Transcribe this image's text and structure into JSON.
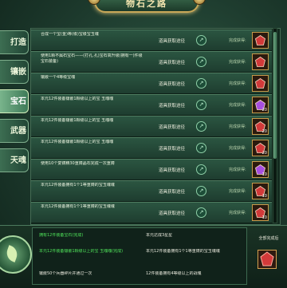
{
  "header": {
    "title": "物石之路"
  },
  "sidebar": {
    "tabs": [
      {
        "label": "打造",
        "active": false
      },
      {
        "label": "镶嵌",
        "active": false
      },
      {
        "label": "宝石",
        "active": true
      },
      {
        "label": "武器",
        "active": false
      },
      {
        "label": "天魂",
        "active": false
      }
    ]
  },
  "tasks": [
    {
      "desc": "合成一个宝(金)等(级)宝级宝玉魂",
      "obtain_label": "道具获取途径",
      "status": "完成获得:",
      "reward_icon": "red-gem",
      "reward_color": "#d23a3a",
      "qty": ""
    },
    {
      "desc": "使用1颗不属石宝石——(打孔,孔)宝石高升级(拥有一)件级宝石装备)",
      "obtain_label": "道具获取途径",
      "status": "完成获得:",
      "reward_icon": "red-gem",
      "reward_color": "#d23a3a",
      "qty": ""
    },
    {
      "desc": "镶嵌一个4等级宝魂",
      "obtain_label": "道具获取途径",
      "status": "完成获得:",
      "reward_icon": "red-gem",
      "reward_color": "#d23a3a",
      "qty": ""
    },
    {
      "desc": "本元12件装备镶嵌1颗级以上的宝 玉魂魂",
      "obtain_label": "道具获取途径",
      "status": "完成获得:",
      "reward_icon": "purple-gem",
      "reward_color": "#a64fe0",
      "qty": "20"
    },
    {
      "desc": "本元12件装备镶嵌1颗级以上的宝 玉魂魂",
      "obtain_label": "道具获取途径",
      "status": "完成获得:",
      "reward_icon": "red-gem",
      "reward_color": "#d23a3a",
      "qty": "20"
    },
    {
      "desc": "本元12件装备镶嵌1颗级以上的宝 玉魂魂",
      "obtain_label": "道具获取途径",
      "status": "完成获得:",
      "reward_icon": "red-gem",
      "reward_color": "#d23a3a",
      "qty": "20"
    },
    {
      "desc": "使用10个复铸精30重铸晶石完成一次重铸",
      "obtain_label": "道具获取途径",
      "status": "完成获得:",
      "reward_icon": "purple-gem",
      "reward_color": "#a64fe0",
      "qty": "10"
    },
    {
      "desc": "本元12件装备拥有1个1等重铸的宝玉魂魂",
      "obtain_label": "道具获取途径",
      "status": "完成获得:",
      "reward_icon": "red-gem",
      "reward_color": "#d23a3a",
      "qty": "10"
    },
    {
      "desc": "本元12件装备拥有1个1等重铸的宝玉魂魂",
      "obtain_label": "道具获取途径",
      "status": "完成获得:",
      "reward_icon": "red-gem",
      "reward_color": "#d23a3a",
      "qty": "10"
    }
  ],
  "bonuses": {
    "col1": [
      {
        "text": "拥有12件装备宝石(完成)",
        "achieved": true
      },
      {
        "text": "本元12件装备镶嵌1颗级以上的宝 玉魂魂(完成)",
        "achieved": true
      },
      {
        "text": "镶嵌50个兵器碎片并通过一次",
        "achieved": false
      }
    ],
    "col2": [
      {
        "text": "本元达成3星星",
        "achieved": false
      },
      {
        "text": "本元12件装备拥有1个1等重铸的宝玉魂魂",
        "achieved": false
      },
      {
        "text": "12件装备拥有4等级以上的战魂",
        "achieved": false
      }
    ]
  },
  "footer": {
    "total_label": "全部完成后"
  },
  "colors": {
    "achieved": "#4fe25a",
    "pending": "#e8e8dc",
    "accent": "#c8a858"
  },
  "scroll": {
    "visible_fraction": 0.67
  }
}
